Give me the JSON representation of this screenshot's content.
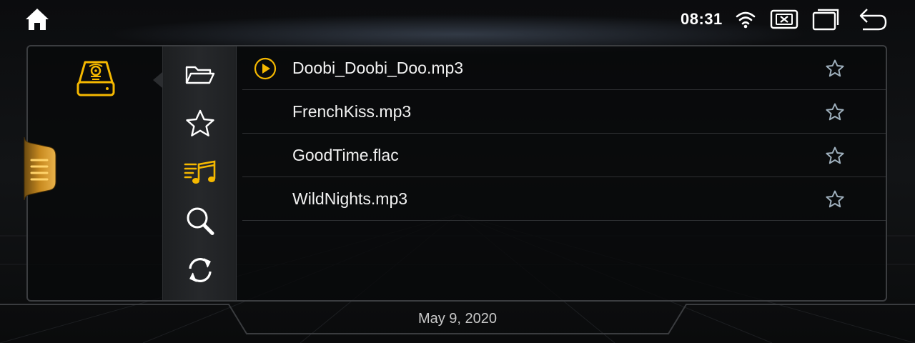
{
  "status_bar": {
    "time": "08:31",
    "icons": [
      "home-icon",
      "wifi-icon",
      "close-app-icon",
      "recent-windows-icon",
      "back-icon"
    ]
  },
  "source": {
    "icon": "usb-drive-icon"
  },
  "nav": {
    "items": [
      {
        "icon": "folder-icon",
        "active": false
      },
      {
        "icon": "star-icon",
        "active": false
      },
      {
        "icon": "music-playlist-icon",
        "active": true
      },
      {
        "icon": "search-icon",
        "active": false
      },
      {
        "icon": "refresh-icon",
        "active": false
      }
    ]
  },
  "tracks": [
    {
      "title": "Doobi_Doobi_Doo.mp3",
      "playing": true
    },
    {
      "title": "FrenchKiss.mp3",
      "playing": false
    },
    {
      "title": "GoodTime.flac",
      "playing": false
    },
    {
      "title": "WildNights.mp3",
      "playing": false
    }
  ],
  "footer": {
    "date": "May 9, 2020"
  },
  "colors": {
    "accent": "#f5b800",
    "background": "#000000",
    "text": "#f2f2f2",
    "icon_gray": "#9fb0bd"
  }
}
